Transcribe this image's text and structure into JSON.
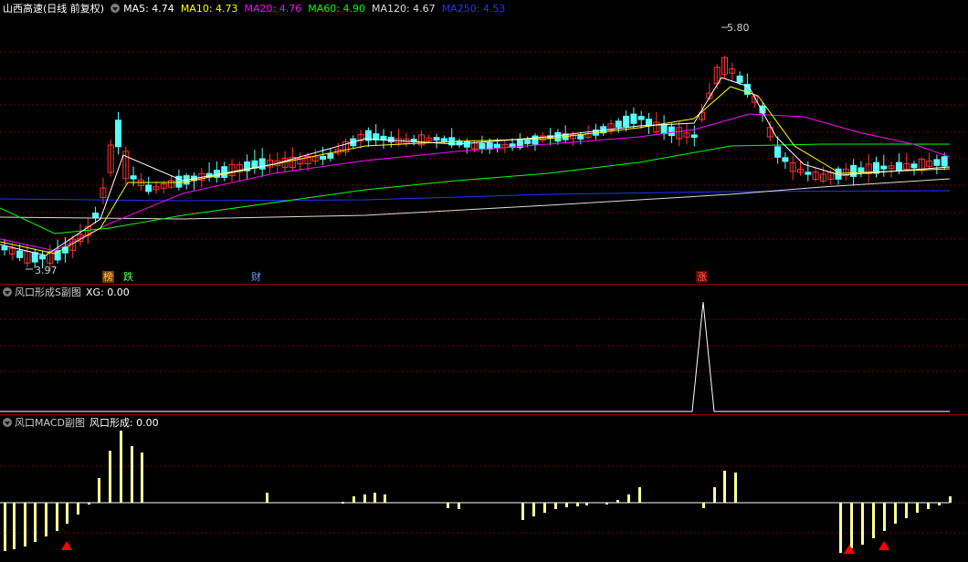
{
  "main": {
    "title": "山西高速(日线 前复权)",
    "ma": [
      {
        "label": "MA5: 4.74",
        "color": "#ffffff"
      },
      {
        "label": "MA10: 4.73",
        "color": "#ffff00"
      },
      {
        "label": "MA20: 4.76",
        "color": "#ff00ff"
      },
      {
        "label": "MA60: 4.90",
        "color": "#00ff00"
      },
      {
        "label": "MA120: 4.67",
        "color": "#dddddd"
      },
      {
        "label": "MA250: 4.53",
        "color": "#2222ff"
      }
    ],
    "high_label": "5.80",
    "low_label": "3.97",
    "tags": [
      {
        "text": "榜",
        "color": "#ffcc66",
        "bg": "#7a3a00"
      },
      {
        "text": "跌",
        "color": "#66ff66",
        "bg": ""
      },
      {
        "text": "财",
        "color": "#6699ff",
        "bg": ""
      },
      {
        "text": "涨",
        "color": "#ff6666",
        "bg": "#6b0000"
      }
    ]
  },
  "xg": {
    "title": "风口形成S副图",
    "value": "XG: 0.00"
  },
  "macd": {
    "title": "风口MACD副图",
    "value": "风口形成: 0.00"
  },
  "colors": {
    "up": "#ff3232",
    "down": "#54ffff",
    "bar": "#ffff99",
    "signal": "#ff0000"
  }
}
